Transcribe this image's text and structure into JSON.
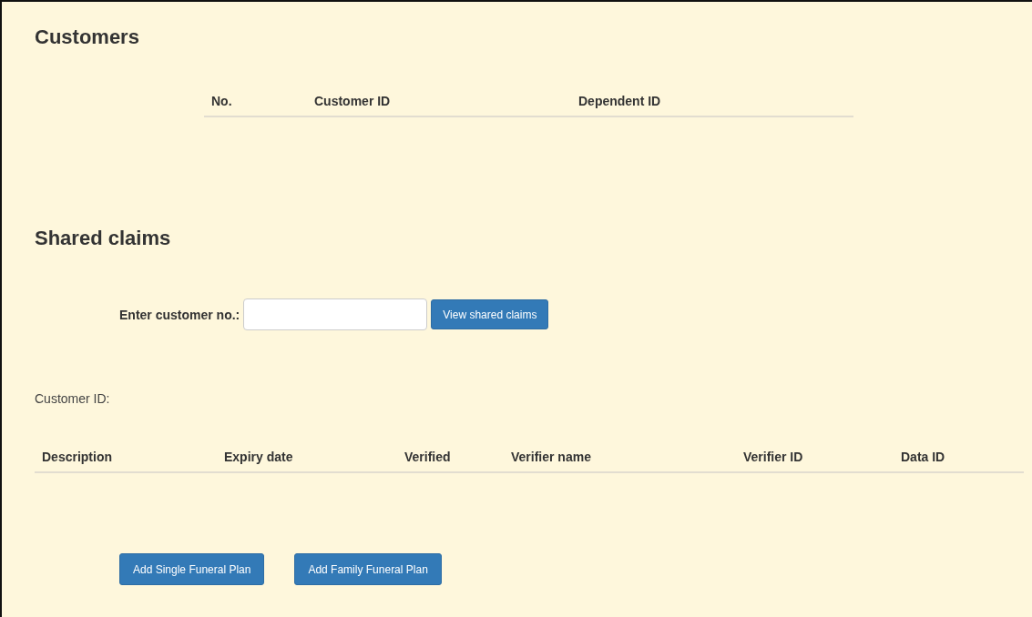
{
  "customers": {
    "title": "Customers",
    "table": {
      "columns": [
        "No.",
        "Customer ID",
        "Dependent ID"
      ]
    }
  },
  "shared_claims": {
    "title": "Shared claims",
    "customer_no": {
      "label": "Enter customer no.:"
    },
    "view_button": "View shared claims",
    "customer_id_label": "Customer ID:",
    "table": {
      "columns": [
        "Description",
        "Expiry date",
        "Verified",
        "Verifier name",
        "Verifier ID",
        "Data ID"
      ]
    }
  },
  "buttons": [
    "Add Single Funeral Plan",
    "Add Family Funeral Plan"
  ]
}
